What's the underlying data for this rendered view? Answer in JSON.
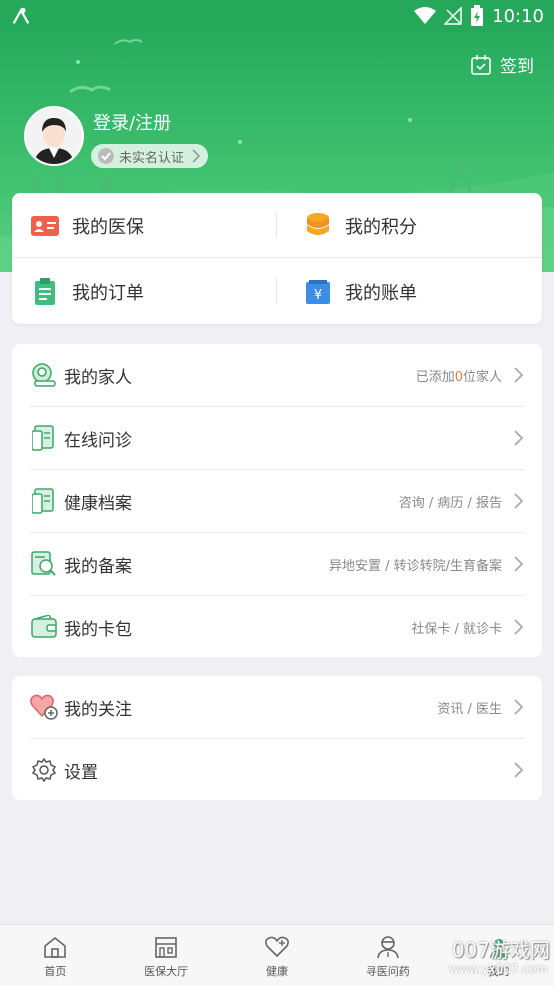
{
  "status_bar": {
    "time": "10:10"
  },
  "header": {
    "signin_label": "签到",
    "user_name": "登录/注册",
    "verify_label": "未实名认证"
  },
  "quick_grid": [
    {
      "label": "我的医保",
      "icon": "medical-card-icon",
      "color": "#f0604a"
    },
    {
      "label": "我的积分",
      "icon": "coins-icon",
      "color": "#f5a623"
    },
    {
      "label": "我的订单",
      "icon": "clipboard-icon",
      "color": "#3fbf7f"
    },
    {
      "label": "我的账单",
      "icon": "bill-icon",
      "color": "#3a8ee6"
    }
  ],
  "list1": [
    {
      "label": "我的家人",
      "sub_prefix": "已添加",
      "sub_count": "0",
      "sub_suffix": "位家人",
      "icon": "family-icon"
    },
    {
      "label": "在线问诊",
      "sub": "",
      "icon": "consult-doc-icon"
    },
    {
      "label": "健康档案",
      "sub": "咨询 / 病历 / 报告",
      "icon": "health-record-icon"
    },
    {
      "label": "我的备案",
      "sub": "异地安置 / 转诊转院/生育备案",
      "icon": "filing-search-icon"
    },
    {
      "label": "我的卡包",
      "sub": "社保卡 / 就诊卡",
      "icon": "wallet-icon"
    }
  ],
  "list2": [
    {
      "label": "我的关注",
      "sub": "资讯 / 医生",
      "icon": "heart-plus-icon"
    },
    {
      "label": "设置",
      "sub": "",
      "icon": "gear-icon"
    }
  ],
  "tabs": [
    {
      "label": "首页",
      "icon": "home-icon"
    },
    {
      "label": "医保大厅",
      "icon": "hall-icon"
    },
    {
      "label": "健康",
      "icon": "heart-icon"
    },
    {
      "label": "寻医问药",
      "icon": "doctor-icon"
    },
    {
      "label": "我的",
      "icon": "profile-icon"
    }
  ],
  "watermark": {
    "text": "007游戏网",
    "sub": "www.yx007.com"
  },
  "colors": {
    "primary": "#26a85a",
    "accent": "#f07b3f"
  }
}
